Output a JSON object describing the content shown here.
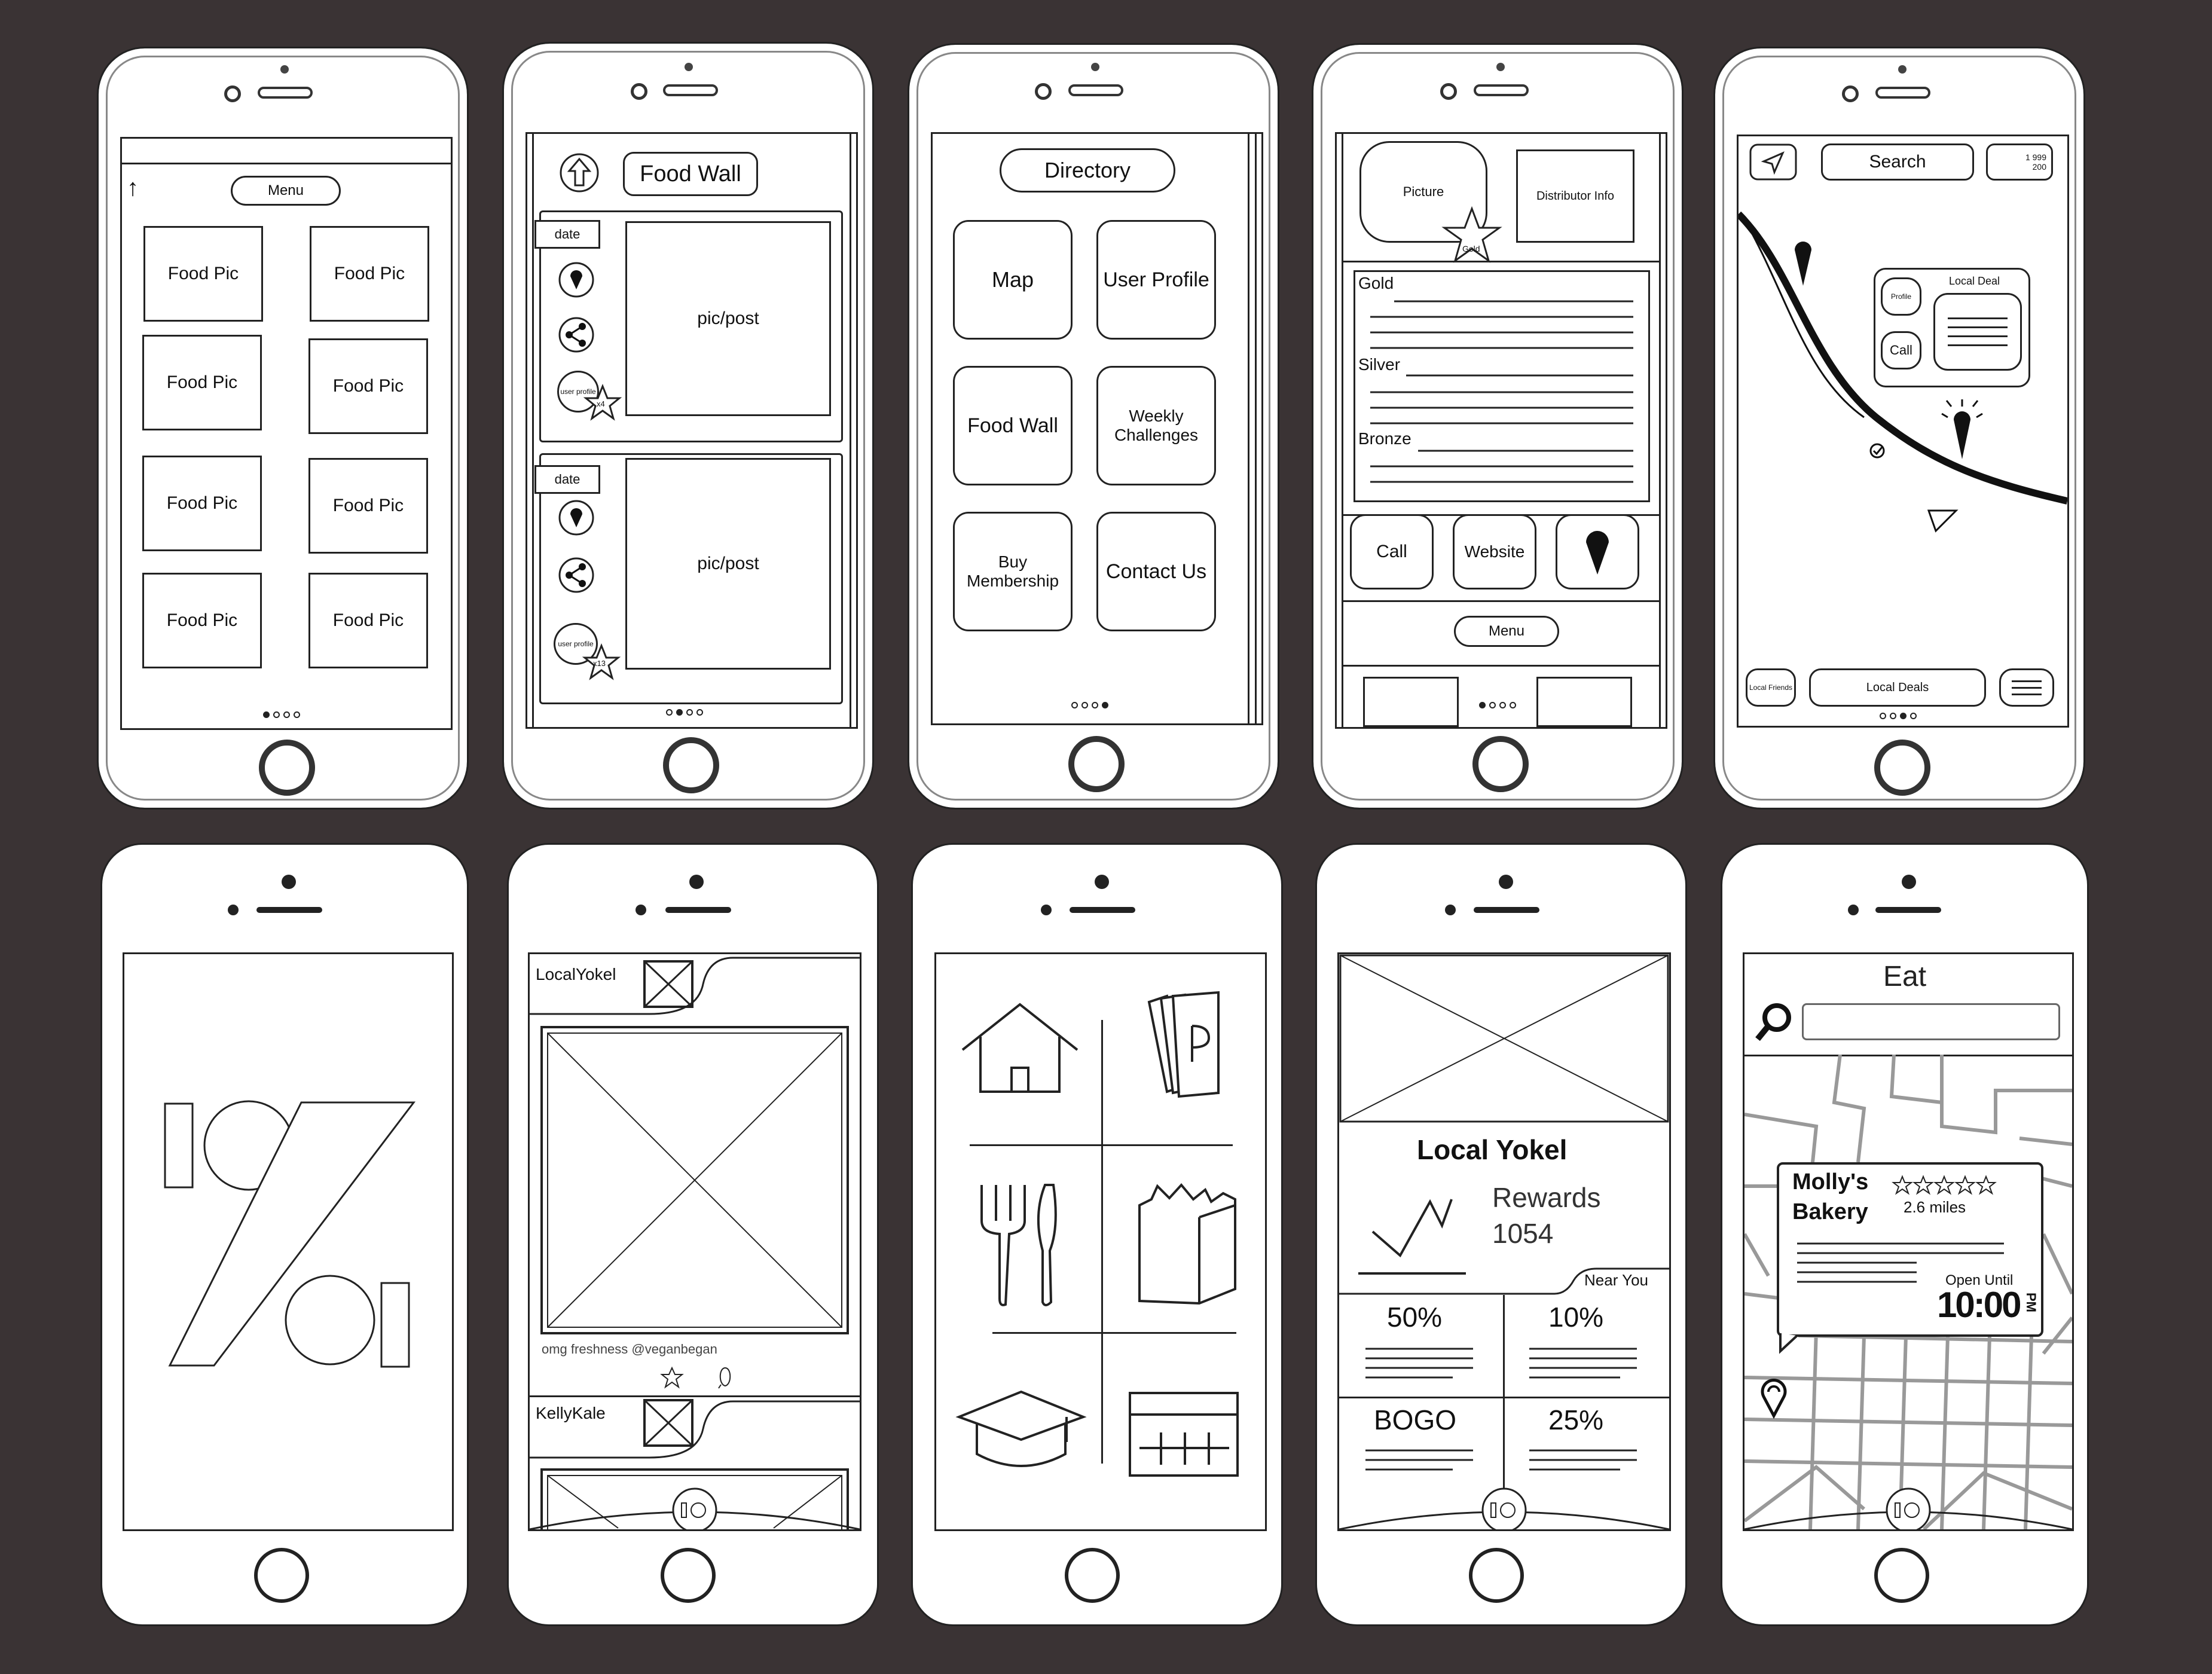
{
  "canvas": {
    "background": "#3a3334"
  },
  "s1": {
    "menu": "Menu",
    "arrow": "↑",
    "tiles": [
      "Food Pic",
      "Food Pic",
      "Food Pic",
      "Food Pic",
      "Food Pic",
      "Food Pic",
      "Food Pic",
      "Food Pic"
    ]
  },
  "s2": {
    "title": "Food Wall",
    "posts": [
      {
        "date": "date",
        "body": "pic/post",
        "profile": "user profile",
        "stars": "x4"
      },
      {
        "date": "date",
        "body": "pic/post",
        "profile": "user profile",
        "stars": "x13"
      }
    ]
  },
  "s3": {
    "title": "Directory",
    "tiles": [
      "Map",
      "User Profile",
      "Food Wall",
      "Weekly Challenges",
      "Buy Membership",
      "Contact Us"
    ]
  },
  "s4": {
    "picture": "Picture",
    "badge": "Gold",
    "distributor": "Distributor Info",
    "tiers": [
      "Gold",
      "Silver",
      "Bronze"
    ],
    "call": "Call",
    "website": "Website",
    "menu": "Menu"
  },
  "s5": {
    "search": "Search",
    "counter_top": "1 999",
    "counter_bottom": "200",
    "popup_profile": "Profile",
    "popup_call": "Call",
    "popup_title": "Local Deal",
    "local_friends": "Local Friends",
    "local_deals": "Local Deals"
  },
  "s7": {
    "items": [
      {
        "user": "LocalYokel",
        "caption": "omg freshness @veganbegan"
      },
      {
        "user": "KellyKale"
      }
    ]
  },
  "s9": {
    "brand": "Local Yokel",
    "rewards_label": "Rewards",
    "rewards_value": "1054",
    "near_you": "Near You",
    "deals": [
      "50%",
      "10%",
      "BOGO",
      "25%"
    ]
  },
  "s10": {
    "title": "Eat",
    "place": "Molly's",
    "place2": "Bakery",
    "distance": "2.6 miles",
    "open_label": "Open Until",
    "time": "10:00",
    "time_suffix": "PM"
  }
}
